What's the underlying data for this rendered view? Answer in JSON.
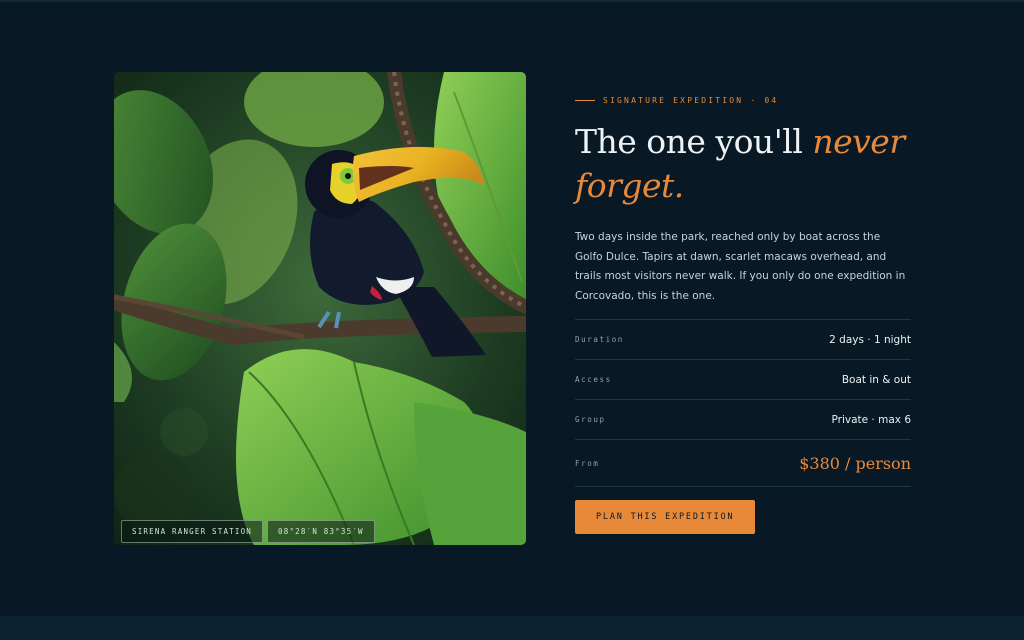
{
  "photo": {
    "tags": [
      "Sirena Ranger Station",
      "08°28′N 83°35′W"
    ]
  },
  "content": {
    "eyebrow": "Signature Expedition · 04",
    "headline_main": "The one you'll ",
    "headline_accent": "never forget.",
    "description": "Two days inside the park, reached only by boat across the Golfo Dulce. Tapirs at dawn, scarlet macaws overhead, and trails most visitors never walk. If you only do one expedition in Corcovado, this is the one.",
    "specs": [
      {
        "label": "Duration",
        "value": "2 days · 1 night"
      },
      {
        "label": "Access",
        "value": "Boat in & out"
      },
      {
        "label": "Group",
        "value": "Private · max 6"
      }
    ],
    "price": {
      "label": "From",
      "value": "$380 / person"
    },
    "cta_label": "Plan this expedition"
  },
  "colors": {
    "background": "#081824",
    "accent": "#e8893a",
    "divider": "#1b3644"
  }
}
